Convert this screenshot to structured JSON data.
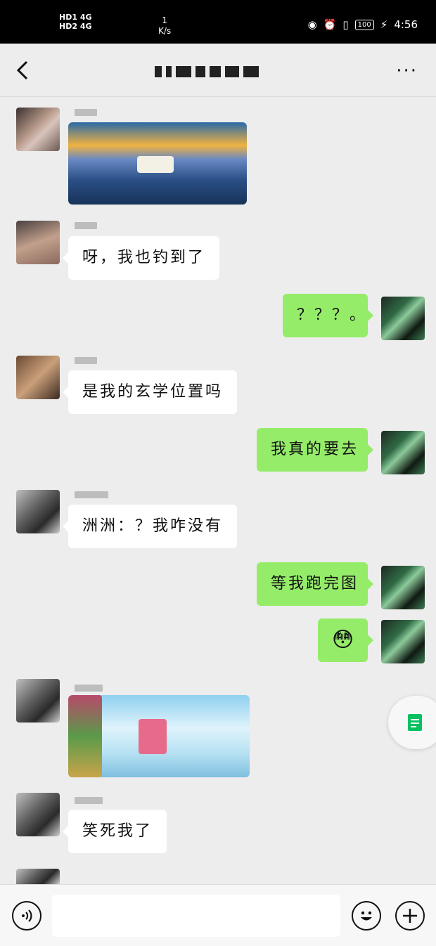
{
  "status_bar": {
    "left_top": "HD1 4G",
    "left_bottom": "HD2 4G",
    "net_speed_value": "1",
    "net_speed_unit": "K/s",
    "battery": "100",
    "time": "4:56"
  },
  "header": {
    "title": "",
    "more_label": "···"
  },
  "messages": [
    {
      "side": "in",
      "type": "image",
      "image_desc": "game-screenshot"
    },
    {
      "side": "in",
      "type": "text",
      "text": "呀，我也钓到了"
    },
    {
      "side": "out",
      "type": "text",
      "text": "？？？。"
    },
    {
      "side": "in",
      "type": "text",
      "text": "是我的玄学位置吗"
    },
    {
      "side": "out",
      "type": "text",
      "text": "我真的要去"
    },
    {
      "side": "in",
      "type": "text",
      "text": "洲洲：？我咋没有"
    },
    {
      "side": "out",
      "type": "text",
      "text": "等我跑完图"
    },
    {
      "side": "out",
      "type": "emoji",
      "text": "😳"
    },
    {
      "side": "in",
      "type": "image",
      "image_desc": "game-screenshot"
    },
    {
      "side": "in",
      "type": "text",
      "text": "笑死我了"
    }
  ],
  "input_bar": {
    "placeholder": "",
    "voice_icon": "voice-icon",
    "emoji_icon": "emoji-icon",
    "plus_icon": "plus-icon"
  },
  "colors": {
    "outgoing_bubble": "#95ec69",
    "incoming_bubble": "#ffffff",
    "background": "#ededed",
    "accent": "#07c160"
  }
}
